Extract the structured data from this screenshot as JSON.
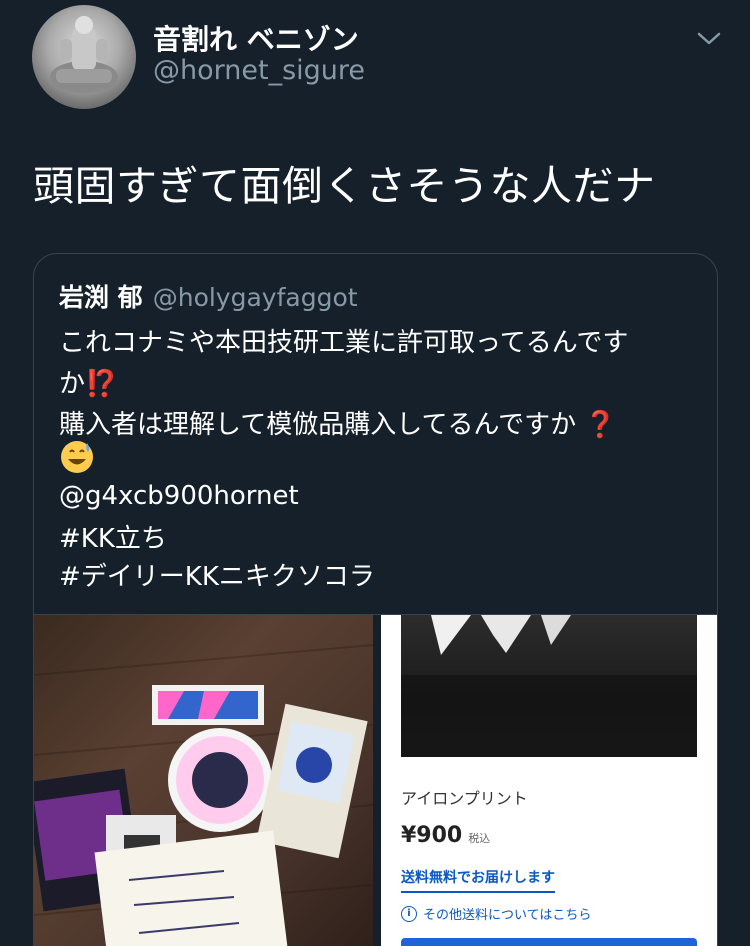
{
  "tweet": {
    "display_name": "音割れ ベニゾン",
    "handle": "@hornet_sigure",
    "text": "頭固すぎて面倒くさそうな人だナ",
    "avatar_icon": "profile-photo-figure-statue",
    "menu_icon": "chevron-down-icon"
  },
  "quoted_tweet": {
    "display_name": "岩渕 郁",
    "handle": "@holygayfaggot",
    "lines": [
      "これコナミや本田技研工業に許可取ってるんです",
      "か",
      "購入者は理解して模倣品購入してるんですか",
      "@g4xcb900hornet",
      "#KK立ち",
      "#デイリーKKニキクソコラ"
    ],
    "emoji_interrobang": "⁉️",
    "emoji_question": "❓",
    "emoji_sweat_smile": "sweat-smile-emoji"
  },
  "media": {
    "left_image": "photo-stickers-cards-and-note",
    "right_image": "screenshot-product-listing",
    "product": {
      "name": "アイロンプリント",
      "price": "¥900",
      "tax_label": "税込",
      "shipping_label": "送料無料でお届けします",
      "shipping_info_label": "その他送料についてはこちら"
    }
  },
  "colors": {
    "background": "#15202b",
    "secondary_text": "#8899a6",
    "border": "#38444d",
    "link_blue": "#0b58c4"
  }
}
